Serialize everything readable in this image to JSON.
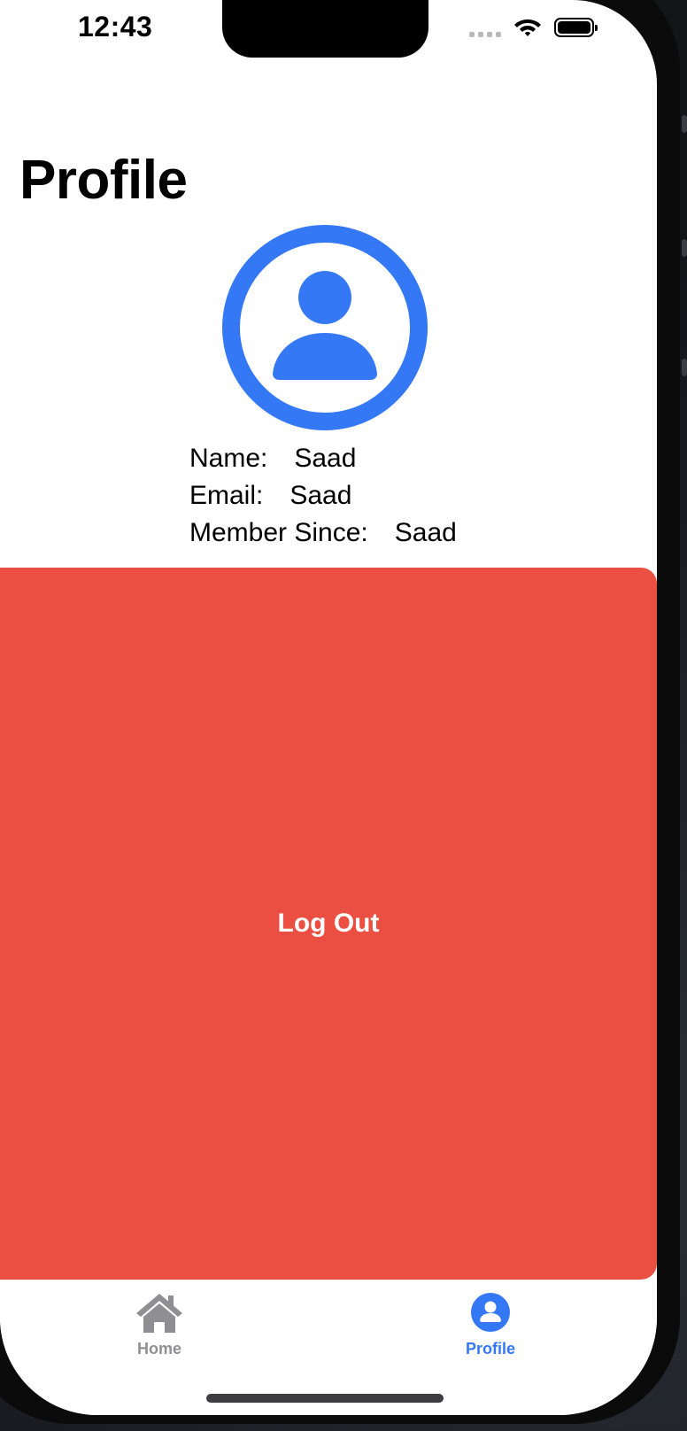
{
  "status_bar": {
    "time": "12:43"
  },
  "page": {
    "title": "Profile"
  },
  "profile": {
    "avatar_icon": "person-circle-icon",
    "name_label": "Name:",
    "name_value": "Saad",
    "email_label": "Email:",
    "email_value": "Saad",
    "member_since_label": "Member Since:",
    "member_since_value": "Saad"
  },
  "actions": {
    "logout_label": "Log Out"
  },
  "tab_bar": {
    "items": [
      {
        "label": "Home",
        "icon": "house-icon",
        "selected": false
      },
      {
        "label": "Profile",
        "icon": "person-circle-fill-icon",
        "selected": true
      }
    ]
  },
  "colors": {
    "accent": "#3478f6",
    "destructive": "#ea4f41",
    "inactive_tab": "#8e8e93"
  }
}
